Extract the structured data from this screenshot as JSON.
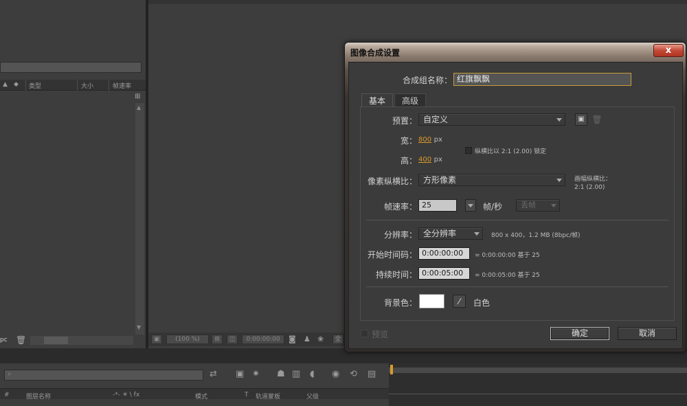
{
  "project_panel": {
    "columns": [
      "类型",
      "大小",
      "帧速率"
    ],
    "bottom_text": "pc"
  },
  "composition_viewer": {
    "zoom": "(100 %)",
    "timecode": "0:00:00:00"
  },
  "timeline": {
    "search_placeholder": "",
    "columns": {
      "hash": "#",
      "layer_name": "图层名称",
      "switches": "-*- ☀ \\ fx",
      "mode": "模式",
      "t": "T",
      "track_matte": "轨道蒙板",
      "parent": "父级"
    }
  },
  "dialog": {
    "title": "图像合成设置",
    "close_label": "x",
    "comp_name_label": "合成组名称：",
    "comp_name_value": "红旗飘飘",
    "tabs": [
      {
        "label": "基本",
        "active": true
      },
      {
        "label": "高级",
        "active": false
      }
    ],
    "preset_label": "预置：",
    "preset_value": "自定义",
    "width_label": "宽：",
    "width_value": "800",
    "height_label": "高：",
    "height_value": "400",
    "px": "px",
    "lock_aspect_label": "纵横比以 2:1 (2.00) 锁定",
    "pixel_aspect_label": "像素纵横比：",
    "pixel_aspect_value": "方形像素",
    "frame_aspect_label": "画幅纵横比：",
    "frame_aspect_value": "2:1 (2.00)",
    "frame_rate_label": "帧速率：",
    "frame_rate_value": "25",
    "frame_rate_unit": "帧/秒",
    "drop_frame_value": "丢帧",
    "resolution_label": "分辨率：",
    "resolution_value": "全分辨率",
    "resolution_info": "800 x 400，1.2 MB (8bpc/帧)",
    "start_tc_label": "开始时间码：",
    "start_tc_value": "0:00:00:00",
    "start_tc_info": "= 0:00:00:00  基于 25",
    "duration_label": "持续时间：",
    "duration_value": "0:00:05:00",
    "duration_info": "= 0:00:05:00  基于 25",
    "bg_color_label": "背景色：",
    "bg_color_hex": "#FFFFFF",
    "bg_color_name": "白色",
    "preview_label": "预览",
    "ok_label": "确定",
    "cancel_label": "取消"
  },
  "colors": {
    "accent_hot_text": "#d99a2b",
    "panel_bg": "#3d3d3d",
    "dialog_bg": "#3b3b3b"
  }
}
